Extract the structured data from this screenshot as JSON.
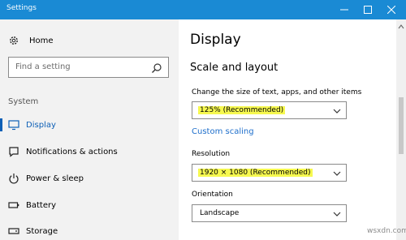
{
  "window": {
    "title": "Settings"
  },
  "sidebar": {
    "home_label": "Home",
    "search_placeholder": "Find a setting",
    "section_label": "System",
    "items": [
      {
        "label": "Display",
        "icon": "monitor-icon",
        "selected": true
      },
      {
        "label": "Notifications & actions",
        "icon": "notification-icon",
        "selected": false
      },
      {
        "label": "Power & sleep",
        "icon": "power-icon",
        "selected": false
      },
      {
        "label": "Battery",
        "icon": "battery-icon",
        "selected": false
      },
      {
        "label": "Storage",
        "icon": "storage-icon",
        "selected": false
      }
    ]
  },
  "main": {
    "title": "Display",
    "section_title": "Scale and layout",
    "scale": {
      "label": "Change the size of text, apps, and other items",
      "value": "125% (Recommended)"
    },
    "custom_scaling_link": "Custom scaling",
    "resolution": {
      "label": "Resolution",
      "value": "1920 × 1080 (Recommended)"
    },
    "orientation": {
      "label": "Orientation",
      "value": "Landscape"
    }
  },
  "watermark": "wsxdn.com",
  "colors": {
    "titlebar": "#1a8ad4",
    "accent": "#0d5fb6",
    "highlight": "#f6f84f",
    "link": "#1d6ecb"
  }
}
